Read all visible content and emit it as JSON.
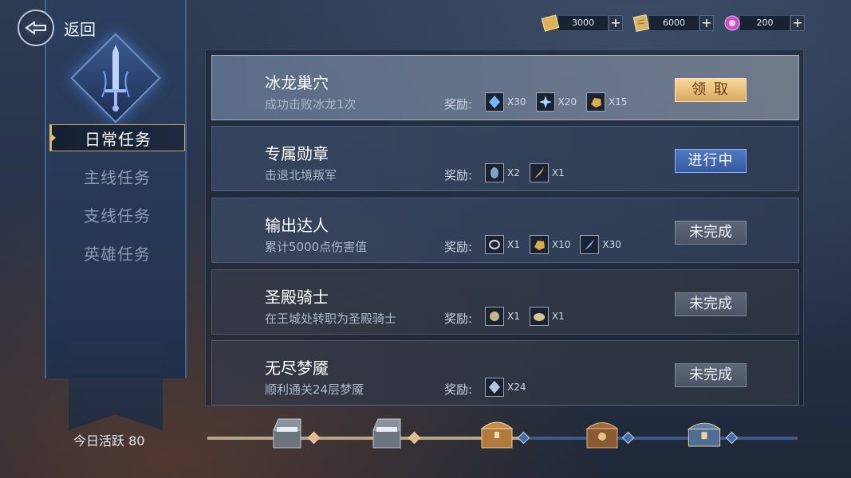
{
  "header": {
    "back_label": "返回",
    "currencies": [
      {
        "icon": "gold-ticket-icon",
        "value": "3000",
        "plus": "+",
        "color": "#d9b25a"
      },
      {
        "icon": "gold-scroll-icon",
        "value": "6000",
        "plus": "+",
        "color": "#d7b565"
      },
      {
        "icon": "purple-gem-icon",
        "value": "200",
        "plus": "+",
        "color": "#c453c7"
      }
    ]
  },
  "sidebar": {
    "emblem_icon": "sword-emblem-icon",
    "items": [
      {
        "label": "日常任务",
        "active": true
      },
      {
        "label": "主线任务",
        "active": false
      },
      {
        "label": "支线任务",
        "active": false
      },
      {
        "label": "英雄任务",
        "active": false
      }
    ],
    "activity_label": "今日活跃 80"
  },
  "quests": [
    {
      "title": "冰龙巢穴",
      "desc": "成功击败冰龙1次",
      "reward_label": "奖励:",
      "rewards": [
        {
          "icon": "blue-crystal-icon",
          "qty": "X30"
        },
        {
          "icon": "ice-shard-icon",
          "qty": "X20"
        },
        {
          "icon": "gold-ore-icon",
          "qty": "X15"
        }
      ],
      "button": "领 取",
      "state": "claim"
    },
    {
      "title": "专属勋章",
      "desc": "击退北境叛军",
      "reward_label": "奖励:",
      "rewards": [
        {
          "icon": "blue-rune-icon",
          "qty": "X2"
        },
        {
          "icon": "gold-feather-icon",
          "qty": "X1"
        }
      ],
      "button": "进行中",
      "state": "progress"
    },
    {
      "title": "输出达人",
      "desc": "累计5000点伤害值",
      "reward_label": "奖励:",
      "rewards": [
        {
          "icon": "silver-ring-icon",
          "qty": "X1"
        },
        {
          "icon": "gold-ore-icon",
          "qty": "X10"
        },
        {
          "icon": "blue-feather-icon",
          "qty": "X30"
        }
      ],
      "button": "未完成",
      "state": "incomplete"
    },
    {
      "title": "圣殿骑士",
      "desc": "在王城处转职为圣殿骑士",
      "reward_label": "奖励:",
      "rewards": [
        {
          "icon": "armor-badge-icon",
          "qty": "X1"
        },
        {
          "icon": "gold-coin-icon",
          "qty": "X1"
        }
      ],
      "button": "未完成",
      "state": "incomplete"
    },
    {
      "title": "无尽梦魇",
      "desc": "顺利通关24层梦魇",
      "reward_label": "奖励:",
      "rewards": [
        {
          "icon": "silver-crystal-icon",
          "qty": "X24"
        }
      ],
      "button": "未完成",
      "state": "incomplete"
    }
  ],
  "activity_track": {
    "progress_fraction": 0.53,
    "chests": [
      {
        "icon": "silver-chest-open-icon",
        "state": "claimed"
      },
      {
        "icon": "silver-chest-open-icon",
        "state": "claimed"
      },
      {
        "icon": "gold-chest-icon",
        "state": "locked"
      },
      {
        "icon": "bronze-chest-icon",
        "state": "locked"
      },
      {
        "icon": "ornate-chest-icon",
        "state": "locked"
      }
    ]
  },
  "colors": {
    "accent_gold": "#d8b66f",
    "claim_button": "#f0c885",
    "progress_button": "#4a70b8",
    "track_blue": "#3c5a8a"
  }
}
